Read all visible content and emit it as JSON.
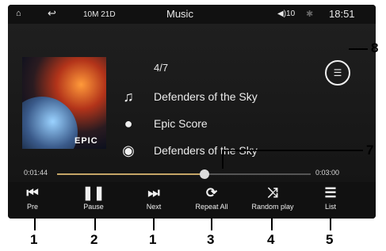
{
  "statusbar": {
    "home_icon": "home-icon",
    "back_icon": "back-icon",
    "date": "10M 21D",
    "title": "Music",
    "volume": "10",
    "volume_icon": "speaker-icon",
    "bluetooth_icon": "bluetooth-icon",
    "time": "18:51"
  },
  "player": {
    "counter": "4/7",
    "track": "Defenders of the Sky",
    "artist": "Epic Score",
    "album": "Defenders of the Sky",
    "album_art_text": "EPIC",
    "elapsed": "0:01:44",
    "total": "0:03:00",
    "progress": 0.58
  },
  "controls": [
    {
      "label": "Pre",
      "icon": "previous-icon"
    },
    {
      "label": "Pause",
      "icon": "pause-icon"
    },
    {
      "label": "Next",
      "icon": "next-icon"
    },
    {
      "label": "Repeat All",
      "icon": "repeat-icon"
    },
    {
      "label": "Random play",
      "icon": "shuffle-icon"
    },
    {
      "label": "List",
      "icon": "list-icon"
    }
  ],
  "callouts": {
    "eq": "8",
    "progress": "7",
    "pre": "1",
    "pause": "2",
    "next": "1",
    "repeat": "3",
    "random": "4",
    "list": "5"
  }
}
